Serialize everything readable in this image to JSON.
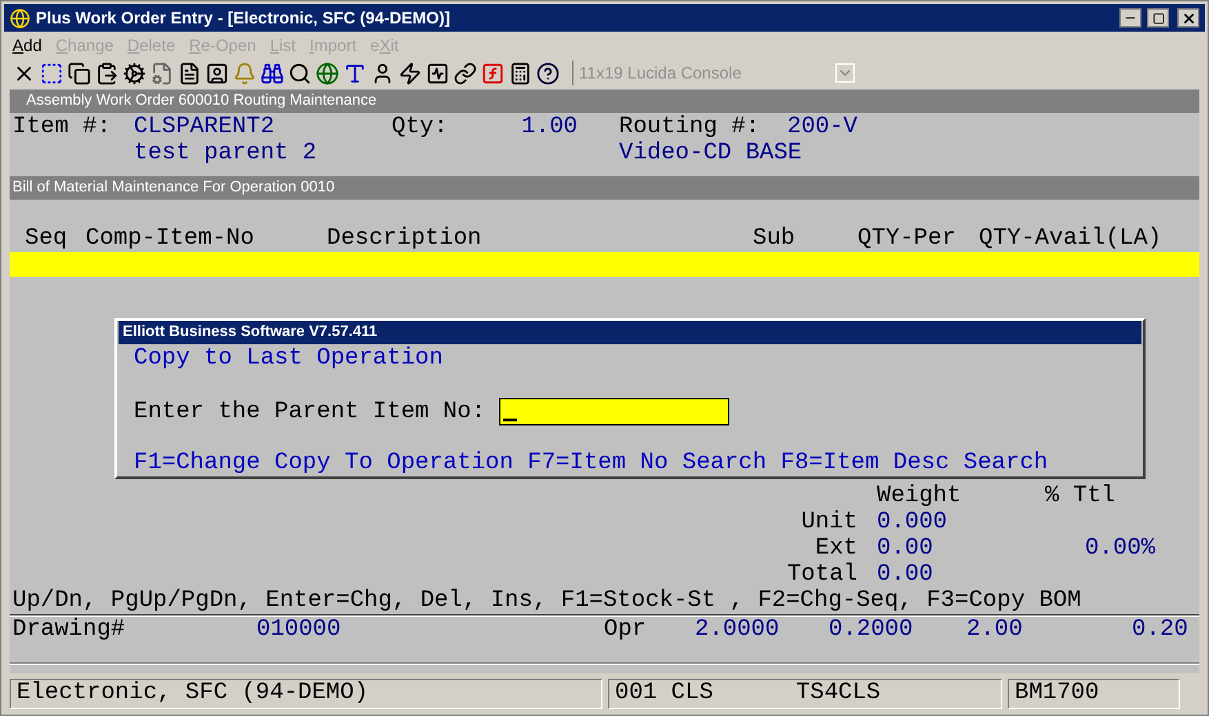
{
  "window": {
    "title": "Plus Work Order Entry - [Electronic, SFC (94-DEMO)]"
  },
  "menu": [
    {
      "key": "A",
      "after": "dd",
      "disabled": false
    },
    {
      "key": "C",
      "after": "hange",
      "disabled": true
    },
    {
      "key": "D",
      "after": "elete",
      "disabled": true
    },
    {
      "key": "R",
      "after": "e-Open",
      "disabled": true
    },
    {
      "key": "L",
      "after": "ist",
      "disabled": true
    },
    {
      "key": "I",
      "after": "mport",
      "disabled": true
    },
    {
      "before": "e",
      "key": "X",
      "after": "it",
      "disabled": true
    }
  ],
  "toolbar": {
    "font_selector": {
      "value": "11x19 Lucida Console",
      "disabled": true
    }
  },
  "routing_panel": {
    "title": "Assembly Work Order 600010 Routing Maintenance",
    "item_label": "Item #:",
    "item_no": "CLSPARENT2",
    "item_desc": "test parent 2",
    "qty_label": "Qty:",
    "qty": "1.00",
    "routing_label": "Routing #:",
    "routing": "200-V",
    "routing_desc": "Video-CD BASE"
  },
  "bom_panel": {
    "title": "Bill of Material Maintenance For Operation 0010",
    "columns": [
      "Seq",
      "Comp-Item-No",
      "Description",
      "Sub",
      "QTY-Per",
      "QTY-Avail(LA)"
    ]
  },
  "dialog": {
    "title": "Elliott Business Software V7.57.411",
    "heading": "Copy to Last Operation",
    "prompt": "Enter the Parent Item No:",
    "keys": "F1=Change Copy To Operation F7=Item No Search F8=Item Desc Search"
  },
  "totals": {
    "headers": [
      "Weight",
      "% Ttl"
    ],
    "rows": [
      {
        "label": "Unit",
        "weight": "0.000"
      },
      {
        "label": "Ext",
        "weight": "0.00",
        "percent": "0.00%"
      },
      {
        "label": "Total",
        "weight": "0.00"
      }
    ]
  },
  "hint": "Up/Dn, PgUp/PgDn, Enter=Chg, Del, Ins, F1=Stock-St , F2=Chg-Seq, F3=Copy BOM",
  "detail_row": {
    "label": "Drawing#",
    "value": "010000",
    "opr_label": "Opr",
    "values": [
      "2.0000",
      "0.2000",
      "2.00",
      "0.20"
    ]
  },
  "status_bar": [
    {
      "texts": [
        "Electronic, SFC (94-DEMO)"
      ]
    },
    {
      "texts": [
        "001 CLS",
        "TS4CLS"
      ]
    },
    {
      "texts": [
        "BM1700"
      ]
    }
  ]
}
